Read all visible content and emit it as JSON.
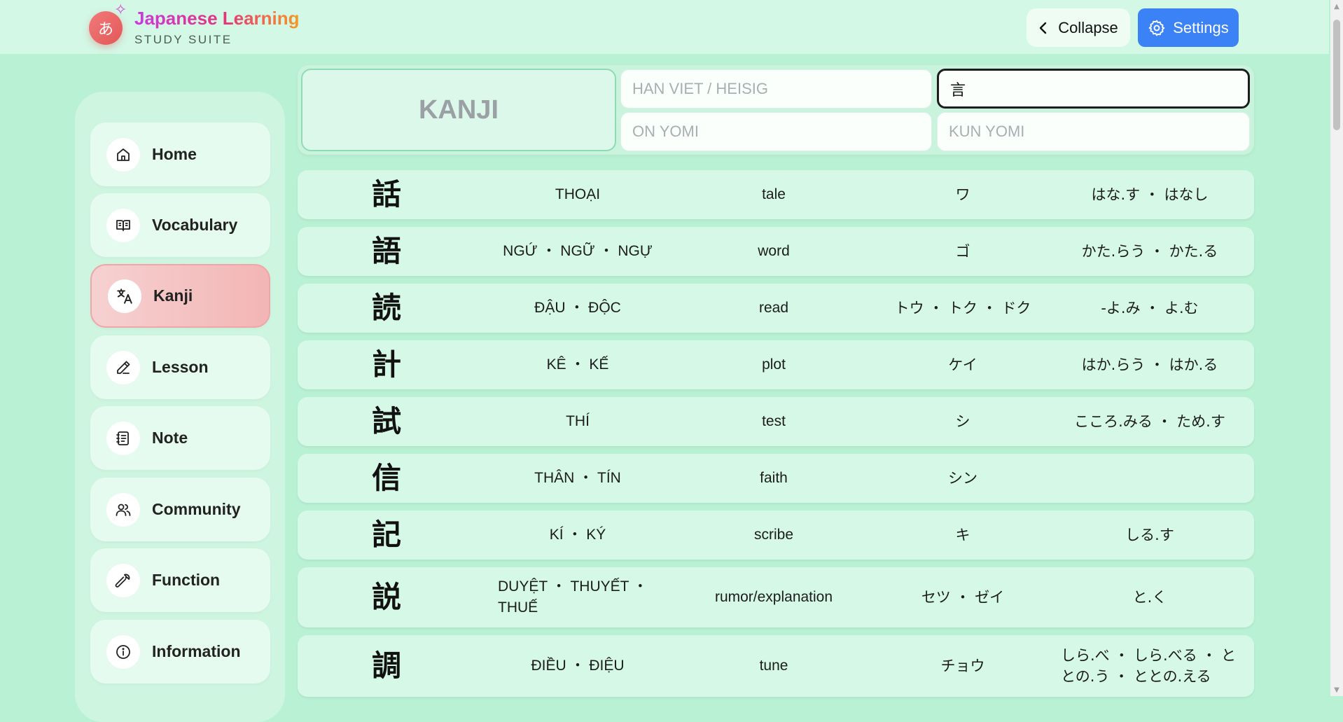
{
  "app": {
    "logo_char": "あ",
    "sparkle": "✧",
    "title": "Japanese Learning",
    "subtitle": "STUDY SUITE"
  },
  "header": {
    "collapse_label": "Collapse",
    "settings_label": "Settings"
  },
  "sidebar": {
    "items": [
      {
        "label": "Home",
        "icon": "home-icon"
      },
      {
        "label": "Vocabulary",
        "icon": "book-open-icon"
      },
      {
        "label": "Kanji",
        "icon": "translate-icon",
        "active": true
      },
      {
        "label": "Lesson",
        "icon": "pencil-icon"
      },
      {
        "label": "Note",
        "icon": "notebook-icon"
      },
      {
        "label": "Community",
        "icon": "users-icon"
      },
      {
        "label": "Function",
        "icon": "wrench-icon"
      },
      {
        "label": "Information",
        "icon": "info-icon"
      }
    ]
  },
  "search": {
    "kanji_label": "KANJI",
    "hanviet_placeholder": "HAN VIET / HEISIG",
    "radical_value": "言",
    "onyomi_placeholder": "ON YOMI",
    "kunyomi_placeholder": "KUN YOMI"
  },
  "kanji_rows": [
    {
      "kanji": "話",
      "hanviet": "THOẠI",
      "meaning": "tale",
      "onyomi": "ワ",
      "kunyomi": "はな.す ・ はなし"
    },
    {
      "kanji": "語",
      "hanviet": "NGỨ ・ NGỮ ・ NGỰ",
      "meaning": "word",
      "onyomi": "ゴ",
      "kunyomi": "かた.らう ・ かた.る"
    },
    {
      "kanji": "読",
      "hanviet": "ĐẬU ・ ĐỘC",
      "meaning": "read",
      "onyomi": "トウ ・ トク ・ ドク",
      "kunyomi": "-よ.み ・ よ.む"
    },
    {
      "kanji": "計",
      "hanviet": "KÊ ・ KẾ",
      "meaning": "plot",
      "onyomi": "ケイ",
      "kunyomi": "はか.らう ・ はか.る"
    },
    {
      "kanji": "試",
      "hanviet": "THÍ",
      "meaning": "test",
      "onyomi": "シ",
      "kunyomi": "こころ.みる ・ ため.す"
    },
    {
      "kanji": "信",
      "hanviet": "THÂN ・ TÍN",
      "meaning": "faith",
      "onyomi": "シン",
      "kunyomi": ""
    },
    {
      "kanji": "記",
      "hanviet": "KÍ ・ KÝ",
      "meaning": "scribe",
      "onyomi": "キ",
      "kunyomi": "しる.す"
    },
    {
      "kanji": "説",
      "hanviet": "DUYỆT ・ THUYẾT ・ THUẾ",
      "meaning": "rumor/explanation",
      "onyomi": "セツ ・ ゼイ",
      "kunyomi": "と.く"
    },
    {
      "kanji": "調",
      "hanviet": "ĐIỀU ・ ĐIỆU",
      "meaning": "tune",
      "onyomi": "チョウ",
      "kunyomi": "しら.べ ・ しら.べる ・ ととの.う ・ ととの.える"
    }
  ],
  "colors": {
    "background": "#b9f1d4",
    "header": "#d3f8e6",
    "accent_blue": "#3b82f6",
    "active_nav": "#f3b5b5",
    "row": "#d6f8e6"
  }
}
